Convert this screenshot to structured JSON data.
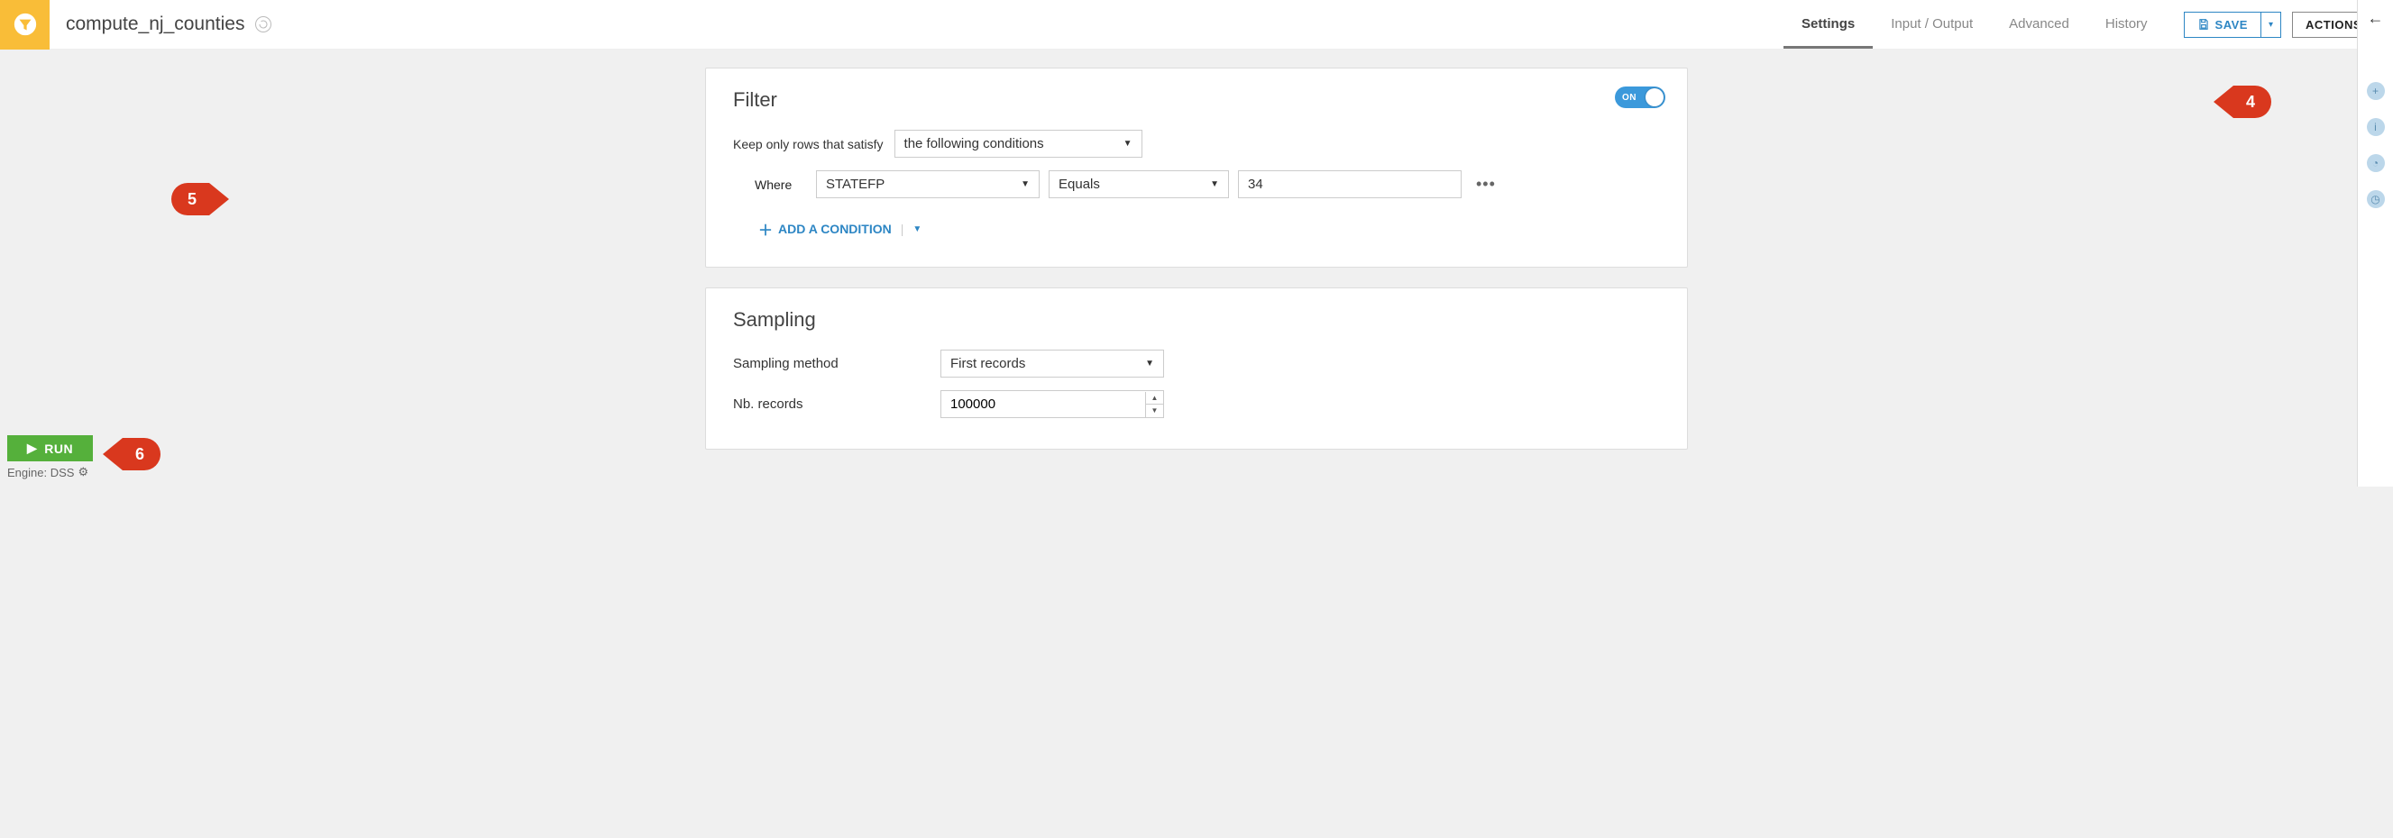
{
  "header": {
    "title": "compute_nj_counties",
    "tabs": {
      "settings": "Settings",
      "io": "Input / Output",
      "advanced": "Advanced",
      "history": "History"
    },
    "save_label": "SAVE",
    "actions_label": "ACTIONS"
  },
  "filter": {
    "title": "Filter",
    "toggle_label": "ON",
    "keep_label": "Keep only rows that satisfy",
    "satisfy_mode": "the following conditions",
    "where_label": "Where",
    "column": "STATEFP",
    "operator": "Equals",
    "value": "34",
    "add_label": "ADD A CONDITION"
  },
  "sampling": {
    "title": "Sampling",
    "method_label": "Sampling method",
    "method_value": "First records",
    "nb_label": "Nb. records",
    "nb_value": "100000"
  },
  "footer": {
    "run_label": "RUN",
    "engine_label": "Engine: DSS"
  },
  "callouts": {
    "c4": "4",
    "c5": "5",
    "c6": "6"
  }
}
